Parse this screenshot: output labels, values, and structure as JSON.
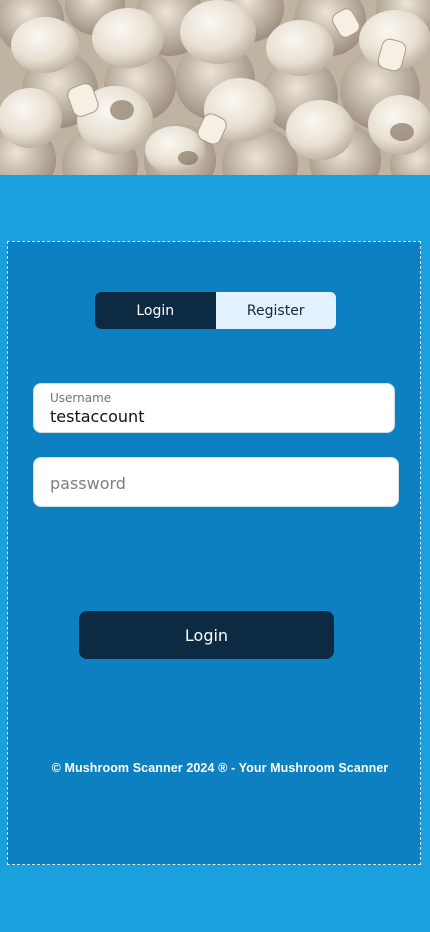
{
  "auth_tabs": {
    "login_label": "Login",
    "register_label": "Register",
    "active": "Login"
  },
  "form": {
    "username_label": "Username",
    "username_value": "testaccount",
    "password_placeholder": "password",
    "submit_label": "Login"
  },
  "footer": {
    "text": "© Mushroom Scanner 2024 ® - Your Mushroom Scanner"
  },
  "colors": {
    "page_background": "#1aa0dd",
    "card_background": "#0c80c1",
    "accent_dark": "#0c2a42",
    "tab_inactive": "#e3f2fc"
  }
}
